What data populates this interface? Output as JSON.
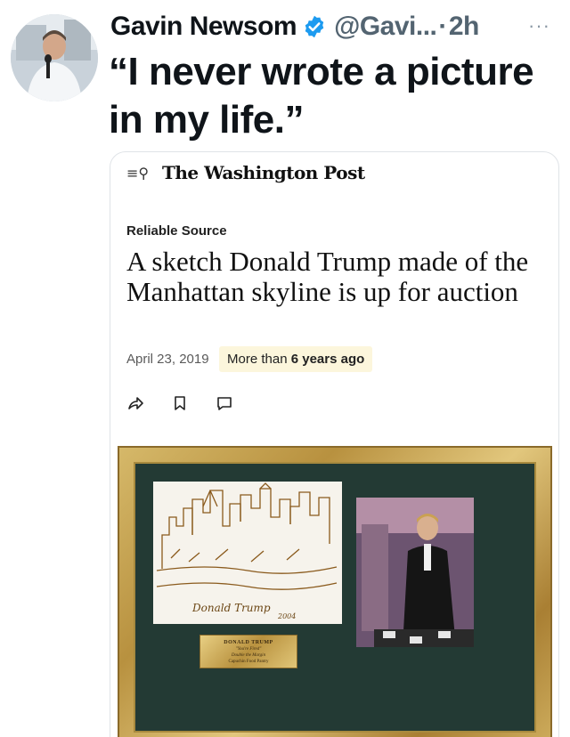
{
  "tweet": {
    "author_name": "Gavin Newsom",
    "handle": "@Gavi...",
    "separator": "·",
    "time": "2h",
    "more_glyph": "···",
    "text": "“I never wrote a picture in my life.”",
    "verified_color": "#1d9bf0"
  },
  "card": {
    "publication": "The Washington Post",
    "menu_icon_glyph": "≡⚲",
    "kicker": "Reliable Source",
    "headline": "A sketch Donald Trump made of the Manhattan skyline is up for auction",
    "date": "April 23, 2019",
    "age_prefix": "More than ",
    "age_value": "6 years ago",
    "icons": [
      "share-icon",
      "bookmark-icon",
      "comment-icon"
    ]
  },
  "artwork": {
    "plaque_line1": "DONALD TRUMP",
    "plaque_line2": "\"You're Fired\"",
    "plaque_line3": "Double the Margin",
    "plaque_line4": "Capuchin Food Pantry",
    "signature": "2004"
  }
}
